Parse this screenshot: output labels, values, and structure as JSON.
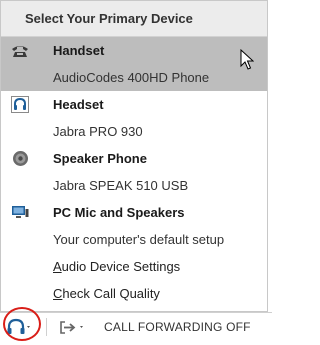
{
  "menu": {
    "header": "Select Your Primary Device",
    "devices": [
      {
        "icon": "desk-phone-icon",
        "name": "Handset",
        "model": "AudioCodes 400HD Phone",
        "selected": true
      },
      {
        "icon": "headset-icon",
        "name": "Headset",
        "model": "Jabra PRO 930",
        "selected": false
      },
      {
        "icon": "speakerphone-icon",
        "name": "Speaker Phone",
        "model": "Jabra SPEAK 510 USB",
        "selected": false
      },
      {
        "icon": "pc-mic-speakers-icon",
        "name": "PC Mic and Speakers",
        "model": "Your computer's default setup",
        "selected": false
      }
    ],
    "audio_settings": {
      "accel": "A",
      "rest": "udio Device Settings"
    },
    "check_call_quality": {
      "accel": "C",
      "rest": "heck Call Quality"
    }
  },
  "statusbar": {
    "call_forwarding": "CALL FORWARDING OFF"
  },
  "colors": {
    "selected_bg": "#bdbdbd",
    "header_bg": "#ececec",
    "highlight_circle": "#d91e18",
    "icon_blue": "#1f5f99"
  }
}
